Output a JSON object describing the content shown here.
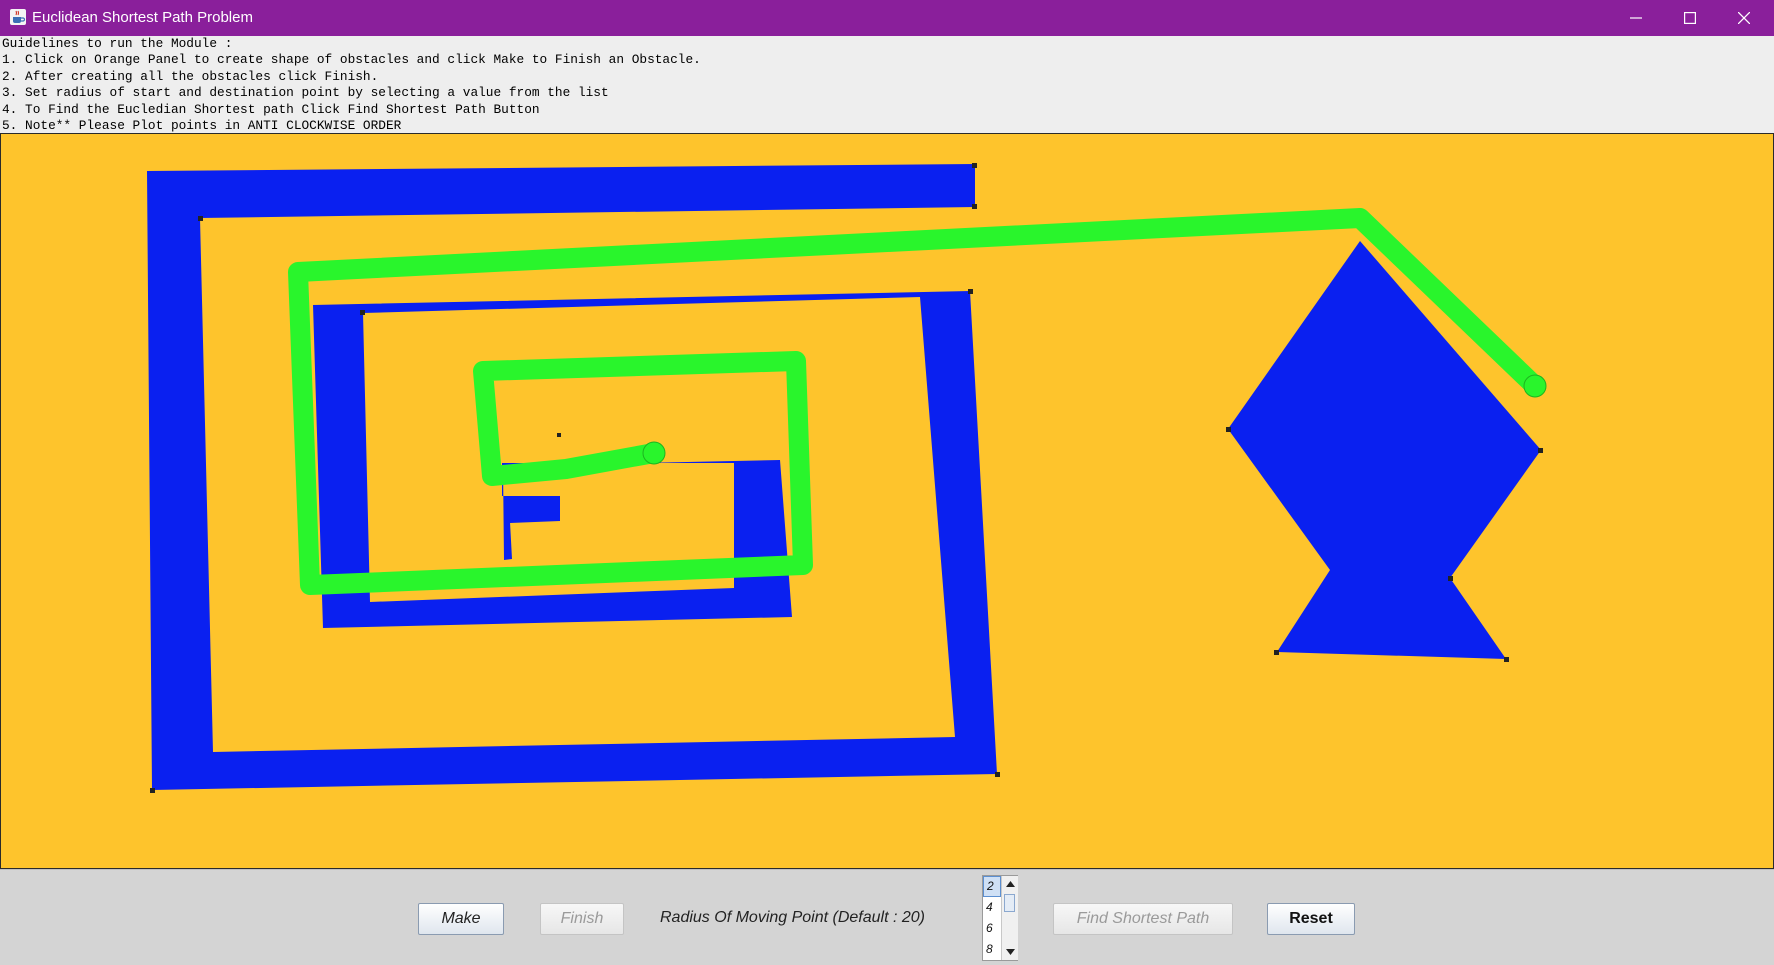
{
  "window": {
    "title": "Euclidean Shortest Path Problem",
    "icon": "java-cup-icon",
    "controls": [
      "minimize-icon",
      "maximize-icon",
      "close-icon"
    ],
    "title_bar_color": "#8a1f9b"
  },
  "guidelines": {
    "lines": [
      "Guidelines to run the Module :",
      "1. Click on Orange Panel to create shape of obstacles and click Make to Finish an Obstacle.",
      "2. After creating all the obstacles click Finish.",
      "3. Set radius of start and destination point by selecting a value from the list",
      "4. To Find the Eucledian Shortest path Click Find Shortest Path Button",
      "5. Note** Please Plot points in ANTI CLOCKWISE ORDER"
    ]
  },
  "canvas": {
    "background_color": "#fec42c",
    "obstacle_color": "#0a20f0",
    "path_color": "#29f52c"
  },
  "controls": {
    "make_label": "Make",
    "finish_label": "Finish",
    "radius_label": "Radius Of Moving Point (Default : 20)",
    "radius_options": [
      "2",
      "4",
      "6",
      "8"
    ],
    "radius_selected": "2",
    "find_label": "Find Shortest Path",
    "reset_label": "Reset"
  }
}
